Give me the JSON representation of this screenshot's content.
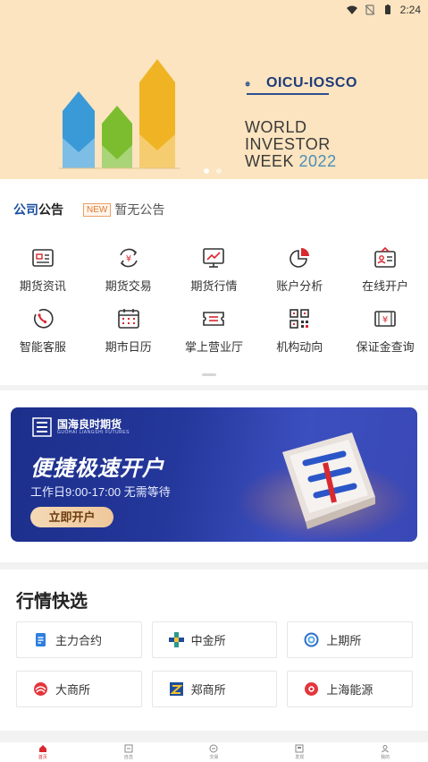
{
  "status_bar": {
    "time": "2:24"
  },
  "banner": {
    "org": "OICU-IOSCO",
    "event_line1": "WORLD",
    "event_line2": "INVESTOR",
    "event_line3_word": "WEEK",
    "event_year": "2022",
    "pages": 2,
    "active_page": 1
  },
  "notice": {
    "title_part1": "公司",
    "title_part2": "公告",
    "badge": "NEW",
    "text": "暂无公告"
  },
  "features": {
    "items": [
      {
        "label": "期货资讯",
        "icon": "news-card-icon"
      },
      {
        "label": "期货交易",
        "icon": "yuan-exchange-icon"
      },
      {
        "label": "期货行情",
        "icon": "chart-monitor-icon"
      },
      {
        "label": "账户分析",
        "icon": "pie-chart-icon"
      },
      {
        "label": "在线开户",
        "icon": "id-card-icon"
      },
      {
        "label": "智能客服",
        "icon": "headset-icon"
      },
      {
        "label": "期市日历",
        "icon": "calendar-icon"
      },
      {
        "label": "掌上营业厅",
        "icon": "ticket-icon"
      },
      {
        "label": "机构动向",
        "icon": "qr-code-icon"
      },
      {
        "label": "保证金查询",
        "icon": "money-bill-icon"
      }
    ]
  },
  "promo": {
    "brand_cn": "国海良时期货",
    "brand_en": "GUOHAI LIANGSHI FUTURES",
    "headline": "便捷极速开户",
    "subline": "工作日9:00-17:00 无需等待",
    "cta": "立即开户"
  },
  "quotes": {
    "title": "行情快选",
    "items": [
      {
        "label": "主力合约",
        "icon": "document-icon"
      },
      {
        "label": "中金所",
        "icon": "cffex-logo-icon"
      },
      {
        "label": "上期所",
        "icon": "shfe-logo-icon"
      },
      {
        "label": "大商所",
        "icon": "dce-logo-icon"
      },
      {
        "label": "郑商所",
        "icon": "czce-logo-icon"
      },
      {
        "label": "上海能源",
        "icon": "ine-logo-icon"
      }
    ]
  },
  "tabbar": {
    "items": [
      {
        "label": "首页",
        "icon": "home-icon",
        "active": true
      },
      {
        "label": "自选",
        "icon": "star-list-icon",
        "active": false
      },
      {
        "label": "交易",
        "icon": "trade-icon",
        "active": false
      },
      {
        "label": "发现",
        "icon": "discover-icon",
        "active": false
      },
      {
        "label": "我的",
        "icon": "user-icon",
        "active": false
      }
    ]
  },
  "colors": {
    "accent_red": "#d8292f",
    "brand_blue": "#1a4fa0",
    "banner_bg": "#fbe4bf",
    "promo_bg": "#24379b"
  }
}
